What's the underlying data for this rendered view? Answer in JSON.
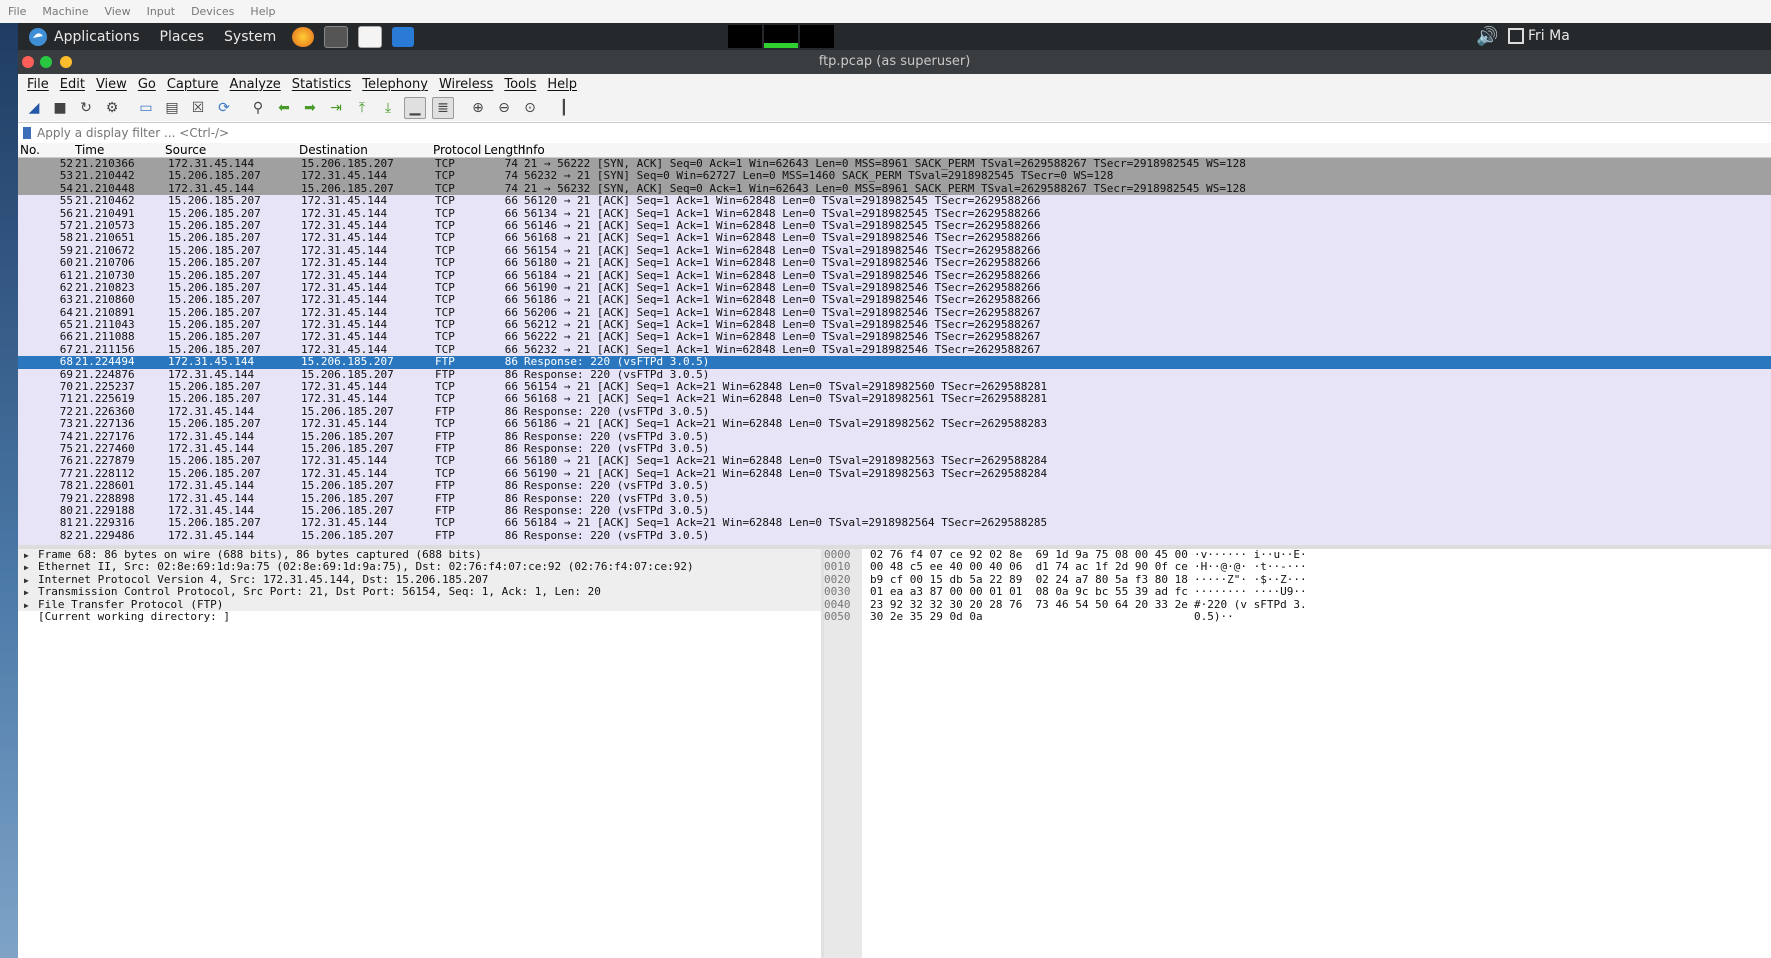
{
  "host_menu": [
    "File",
    "Machine",
    "View",
    "Input",
    "Devices",
    "Help"
  ],
  "panel": {
    "applications": "Applications",
    "places": "Places",
    "system": "System",
    "clock": "Fri Ma"
  },
  "window": {
    "title": "ftp.pcap (as superuser)"
  },
  "menu": [
    "File",
    "Edit",
    "View",
    "Go",
    "Capture",
    "Analyze",
    "Statistics",
    "Telephony",
    "Wireless",
    "Tools",
    "Help"
  ],
  "toolbar_icons": [
    "shark-fin-start-icon",
    "stop-icon",
    "restart-icon",
    "capture-options-icon",
    "open-folder-icon",
    "save-icon",
    "close-file-icon",
    "reload-icon",
    "find-icon",
    "back-arrow-icon",
    "forward-arrow-icon",
    "go-to-packet-icon",
    "first-packet-icon",
    "last-packet-icon",
    "autoscroll-icon",
    "colorize-icon",
    "zoom-in-icon",
    "zoom-out-icon",
    "zoom-reset-icon",
    "resize-columns-icon"
  ],
  "filter": {
    "placeholder": "Apply a display filter ... <Ctrl-/>"
  },
  "columns": {
    "no": "No.",
    "time": "Time",
    "source": "Source",
    "destination": "Destination",
    "protocol": "Protocol",
    "length": "Length",
    "info": "Info"
  },
  "packets": [
    {
      "no": "52",
      "time": "21.210366",
      "src": "172.31.45.144",
      "dst": "15.206.185.207",
      "proto": "TCP",
      "len": "74",
      "info": "21 → 56222 [SYN, ACK] Seq=0 Ack=1 Win=62643 Len=0 MSS=8961 SACK_PERM TSval=2629588267 TSecr=2918982545 WS=128",
      "style": "syn"
    },
    {
      "no": "53",
      "time": "21.210442",
      "src": "15.206.185.207",
      "dst": "172.31.45.144",
      "proto": "TCP",
      "len": "74",
      "info": "56232 → 21 [SYN] Seq=0 Win=62727 Len=0 MSS=1460 SACK_PERM TSval=2918982545 TSecr=0 WS=128",
      "style": "syn"
    },
    {
      "no": "54",
      "time": "21.210448",
      "src": "172.31.45.144",
      "dst": "15.206.185.207",
      "proto": "TCP",
      "len": "74",
      "info": "21 → 56232 [SYN, ACK] Seq=0 Ack=1 Win=62643 Len=0 MSS=8961 SACK_PERM TSval=2629588267 TSecr=2918982545 WS=128",
      "style": "syn"
    },
    {
      "no": "55",
      "time": "21.210462",
      "src": "15.206.185.207",
      "dst": "172.31.45.144",
      "proto": "TCP",
      "len": "66",
      "info": "56120 → 21 [ACK] Seq=1 Ack=1 Win=62848 Len=0 TSval=2918982545 TSecr=2629588266",
      "style": "ack"
    },
    {
      "no": "56",
      "time": "21.210491",
      "src": "15.206.185.207",
      "dst": "172.31.45.144",
      "proto": "TCP",
      "len": "66",
      "info": "56134 → 21 [ACK] Seq=1 Ack=1 Win=62848 Len=0 TSval=2918982545 TSecr=2629588266",
      "style": "ack"
    },
    {
      "no": "57",
      "time": "21.210573",
      "src": "15.206.185.207",
      "dst": "172.31.45.144",
      "proto": "TCP",
      "len": "66",
      "info": "56146 → 21 [ACK] Seq=1 Ack=1 Win=62848 Len=0 TSval=2918982545 TSecr=2629588266",
      "style": "ack"
    },
    {
      "no": "58",
      "time": "21.210651",
      "src": "15.206.185.207",
      "dst": "172.31.45.144",
      "proto": "TCP",
      "len": "66",
      "info": "56168 → 21 [ACK] Seq=1 Ack=1 Win=62848 Len=0 TSval=2918982546 TSecr=2629588266",
      "style": "ack"
    },
    {
      "no": "59",
      "time": "21.210672",
      "src": "15.206.185.207",
      "dst": "172.31.45.144",
      "proto": "TCP",
      "len": "66",
      "info": "56154 → 21 [ACK] Seq=1 Ack=1 Win=62848 Len=0 TSval=2918982546 TSecr=2629588266",
      "style": "ack"
    },
    {
      "no": "60",
      "time": "21.210706",
      "src": "15.206.185.207",
      "dst": "172.31.45.144",
      "proto": "TCP",
      "len": "66",
      "info": "56180 → 21 [ACK] Seq=1 Ack=1 Win=62848 Len=0 TSval=2918982546 TSecr=2629588266",
      "style": "ack"
    },
    {
      "no": "61",
      "time": "21.210730",
      "src": "15.206.185.207",
      "dst": "172.31.45.144",
      "proto": "TCP",
      "len": "66",
      "info": "56184 → 21 [ACK] Seq=1 Ack=1 Win=62848 Len=0 TSval=2918982546 TSecr=2629588266",
      "style": "ack"
    },
    {
      "no": "62",
      "time": "21.210823",
      "src": "15.206.185.207",
      "dst": "172.31.45.144",
      "proto": "TCP",
      "len": "66",
      "info": "56190 → 21 [ACK] Seq=1 Ack=1 Win=62848 Len=0 TSval=2918982546 TSecr=2629588266",
      "style": "ack"
    },
    {
      "no": "63",
      "time": "21.210860",
      "src": "15.206.185.207",
      "dst": "172.31.45.144",
      "proto": "TCP",
      "len": "66",
      "info": "56186 → 21 [ACK] Seq=1 Ack=1 Win=62848 Len=0 TSval=2918982546 TSecr=2629588266",
      "style": "ack"
    },
    {
      "no": "64",
      "time": "21.210891",
      "src": "15.206.185.207",
      "dst": "172.31.45.144",
      "proto": "TCP",
      "len": "66",
      "info": "56206 → 21 [ACK] Seq=1 Ack=1 Win=62848 Len=0 TSval=2918982546 TSecr=2629588267",
      "style": "ack"
    },
    {
      "no": "65",
      "time": "21.211043",
      "src": "15.206.185.207",
      "dst": "172.31.45.144",
      "proto": "TCP",
      "len": "66",
      "info": "56212 → 21 [ACK] Seq=1 Ack=1 Win=62848 Len=0 TSval=2918982546 TSecr=2629588267",
      "style": "ack"
    },
    {
      "no": "66",
      "time": "21.211088",
      "src": "15.206.185.207",
      "dst": "172.31.45.144",
      "proto": "TCP",
      "len": "66",
      "info": "56222 → 21 [ACK] Seq=1 Ack=1 Win=62848 Len=0 TSval=2918982546 TSecr=2629588267",
      "style": "ack"
    },
    {
      "no": "67",
      "time": "21.211156",
      "src": "15.206.185.207",
      "dst": "172.31.45.144",
      "proto": "TCP",
      "len": "66",
      "info": "56232 → 21 [ACK] Seq=1 Ack=1 Win=62848 Len=0 TSval=2918982546 TSecr=2629588267",
      "style": "ack"
    },
    {
      "no": "68",
      "time": "21.224494",
      "src": "172.31.45.144",
      "dst": "15.206.185.207",
      "proto": "FTP",
      "len": "86",
      "info": "Response: 220 (vsFTPd 3.0.5)",
      "style": "sel"
    },
    {
      "no": "69",
      "time": "21.224876",
      "src": "172.31.45.144",
      "dst": "15.206.185.207",
      "proto": "FTP",
      "len": "86",
      "info": "Response: 220 (vsFTPd 3.0.5)",
      "style": "ack"
    },
    {
      "no": "70",
      "time": "21.225237",
      "src": "15.206.185.207",
      "dst": "172.31.45.144",
      "proto": "TCP",
      "len": "66",
      "info": "56154 → 21 [ACK] Seq=1 Ack=21 Win=62848 Len=0 TSval=2918982560 TSecr=2629588281",
      "style": "ack"
    },
    {
      "no": "71",
      "time": "21.225619",
      "src": "15.206.185.207",
      "dst": "172.31.45.144",
      "proto": "TCP",
      "len": "66",
      "info": "56168 → 21 [ACK] Seq=1 Ack=21 Win=62848 Len=0 TSval=2918982561 TSecr=2629588281",
      "style": "ack"
    },
    {
      "no": "72",
      "time": "21.226360",
      "src": "172.31.45.144",
      "dst": "15.206.185.207",
      "proto": "FTP",
      "len": "86",
      "info": "Response: 220 (vsFTPd 3.0.5)",
      "style": "ack"
    },
    {
      "no": "73",
      "time": "21.227136",
      "src": "15.206.185.207",
      "dst": "172.31.45.144",
      "proto": "TCP",
      "len": "66",
      "info": "56186 → 21 [ACK] Seq=1 Ack=21 Win=62848 Len=0 TSval=2918982562 TSecr=2629588283",
      "style": "ack"
    },
    {
      "no": "74",
      "time": "21.227176",
      "src": "172.31.45.144",
      "dst": "15.206.185.207",
      "proto": "FTP",
      "len": "86",
      "info": "Response: 220 (vsFTPd 3.0.5)",
      "style": "ack"
    },
    {
      "no": "75",
      "time": "21.227460",
      "src": "172.31.45.144",
      "dst": "15.206.185.207",
      "proto": "FTP",
      "len": "86",
      "info": "Response: 220 (vsFTPd 3.0.5)",
      "style": "ack"
    },
    {
      "no": "76",
      "time": "21.227879",
      "src": "15.206.185.207",
      "dst": "172.31.45.144",
      "proto": "TCP",
      "len": "66",
      "info": "56180 → 21 [ACK] Seq=1 Ack=21 Win=62848 Len=0 TSval=2918982563 TSecr=2629588284",
      "style": "ack"
    },
    {
      "no": "77",
      "time": "21.228112",
      "src": "15.206.185.207",
      "dst": "172.31.45.144",
      "proto": "TCP",
      "len": "66",
      "info": "56190 → 21 [ACK] Seq=1 Ack=21 Win=62848 Len=0 TSval=2918982563 TSecr=2629588284",
      "style": "ack"
    },
    {
      "no": "78",
      "time": "21.228601",
      "src": "172.31.45.144",
      "dst": "15.206.185.207",
      "proto": "FTP",
      "len": "86",
      "info": "Response: 220 (vsFTPd 3.0.5)",
      "style": "ack"
    },
    {
      "no": "79",
      "time": "21.228898",
      "src": "172.31.45.144",
      "dst": "15.206.185.207",
      "proto": "FTP",
      "len": "86",
      "info": "Response: 220 (vsFTPd 3.0.5)",
      "style": "ack"
    },
    {
      "no": "80",
      "time": "21.229188",
      "src": "172.31.45.144",
      "dst": "15.206.185.207",
      "proto": "FTP",
      "len": "86",
      "info": "Response: 220 (vsFTPd 3.0.5)",
      "style": "ack"
    },
    {
      "no": "81",
      "time": "21.229316",
      "src": "15.206.185.207",
      "dst": "172.31.45.144",
      "proto": "TCP",
      "len": "66",
      "info": "56184 → 21 [ACK] Seq=1 Ack=21 Win=62848 Len=0 TSval=2918982564 TSecr=2629588285",
      "style": "ack"
    },
    {
      "no": "82",
      "time": "21.229486",
      "src": "172.31.45.144",
      "dst": "15.206.185.207",
      "proto": "FTP",
      "len": "86",
      "info": "Response: 220 (vsFTPd 3.0.5)",
      "style": "ack"
    }
  ],
  "details": [
    {
      "text": "Frame 68: 86 bytes on wire (688 bits), 86 bytes captured (688 bits)",
      "expand": true
    },
    {
      "text": "Ethernet II, Src: 02:8e:69:1d:9a:75 (02:8e:69:1d:9a:75), Dst: 02:76:f4:07:ce:92 (02:76:f4:07:ce:92)",
      "expand": true
    },
    {
      "text": "Internet Protocol Version 4, Src: 172.31.45.144, Dst: 15.206.185.207",
      "expand": true
    },
    {
      "text": "Transmission Control Protocol, Src Port: 21, Dst Port: 56154, Seq: 1, Ack: 1, Len: 20",
      "expand": true
    },
    {
      "text": "File Transfer Protocol (FTP)",
      "expand": true
    },
    {
      "text": "[Current working directory: ]",
      "expand": false
    }
  ],
  "bytes": [
    {
      "off": "0000",
      "hex": "02 76 f4 07 ce 92 02 8e  69 1d 9a 75 08 00 45 00",
      "ascii": "·v······ i··u··E·"
    },
    {
      "off": "0010",
      "hex": "00 48 c5 ee 40 00 40 06  d1 74 ac 1f 2d 90 0f ce",
      "ascii": "·H··@·@· ·t··-···"
    },
    {
      "off": "0020",
      "hex": "b9 cf 00 15 db 5a 22 89  02 24 a7 80 5a f3 80 18",
      "ascii": "·····Z\"· ·$··Z···"
    },
    {
      "off": "0030",
      "hex": "01 ea a3 87 00 00 01 01  08 0a 9c bc 55 39 ad fc",
      "ascii": "········ ····U9··"
    },
    {
      "off": "0040",
      "hex": "23 92 32 32 30 20 28 76  73 46 54 50 64 20 33 2e",
      "ascii": "#·220 (v sFTPd 3."
    },
    {
      "off": "0050",
      "hex": "30 2e 35 29 0d 0a",
      "ascii": "0.5)··"
    }
  ],
  "colors": {
    "selected": "#2a77c0",
    "syn": "#a0a0a0",
    "tcp": "#e8e4f8"
  }
}
